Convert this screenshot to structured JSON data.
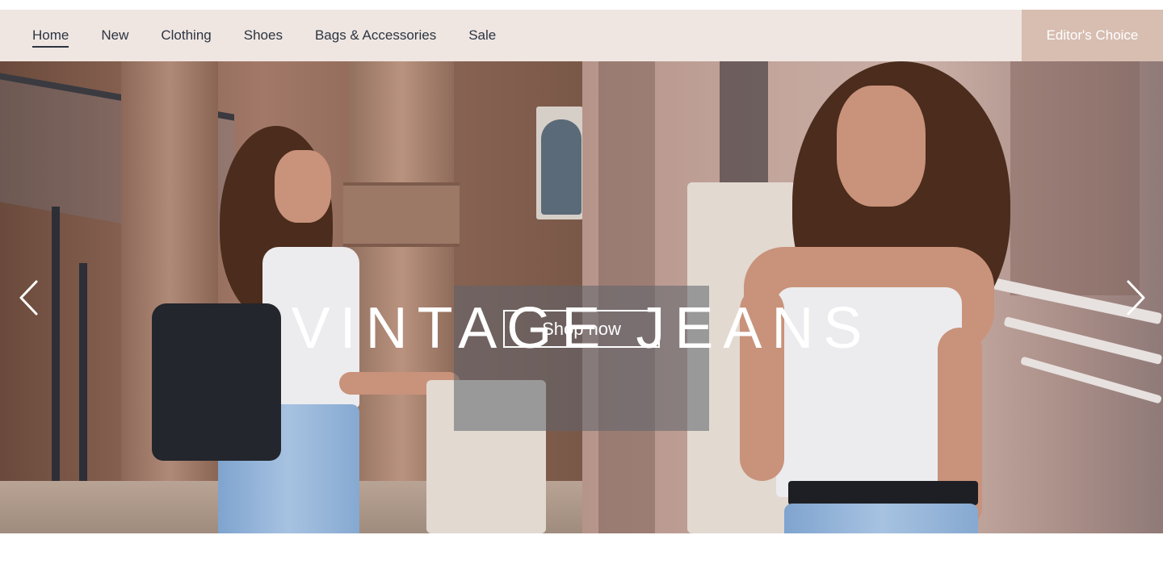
{
  "nav": {
    "items": [
      {
        "label": "Home",
        "active": true
      },
      {
        "label": "New",
        "active": false
      },
      {
        "label": "Clothing",
        "active": false
      },
      {
        "label": "Shoes",
        "active": false
      },
      {
        "label": "Bags & Accessories",
        "active": false
      },
      {
        "label": "Sale",
        "active": false
      }
    ],
    "cta_label": "Editor's Choice"
  },
  "hero": {
    "title": "VINTAGE JEANS",
    "button_label": "Shop now",
    "prev_icon": "chevron-left-icon",
    "next_icon": "chevron-right-icon"
  },
  "colors": {
    "nav_background": "#efe6e2",
    "cta_background": "#d7beb1",
    "text_dark": "#2c3440",
    "overlay": "#5f646e"
  }
}
